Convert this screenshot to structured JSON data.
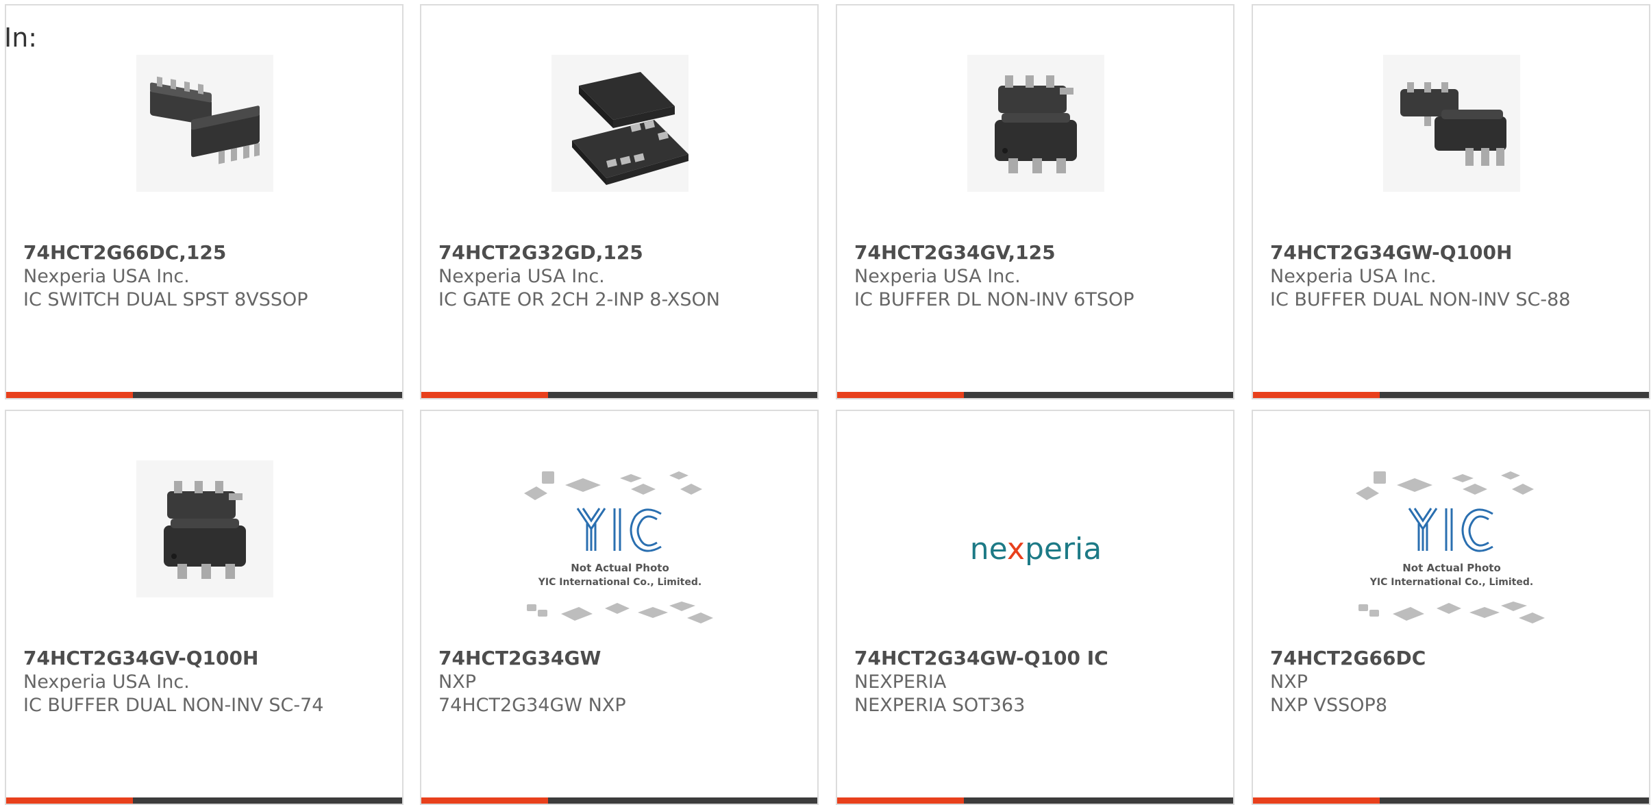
{
  "page": {
    "label": "In:"
  },
  "colors": {
    "accent": "#e8401c",
    "bar": "#3c3c3c",
    "border": "#dcdcdc",
    "text": "#4d4d4d",
    "muted": "#666666"
  },
  "cards": [
    {
      "part": "74HCT2G66DC,125",
      "manufacturer": "Nexperia USA Inc.",
      "description": "IC SWITCH DUAL SPST 8VSSOP",
      "image": "ic-8vssop-photo",
      "bar_fraction": 0.32
    },
    {
      "part": "74HCT2G32GD,125",
      "manufacturer": "Nexperia USA Inc.",
      "description": "IC GATE OR 2CH 2-INP 8-XSON",
      "image": "ic-xson-photo",
      "bar_fraction": 0.32
    },
    {
      "part": "74HCT2G34GV,125",
      "manufacturer": "Nexperia USA Inc.",
      "description": "IC BUFFER DL NON-INV 6TSOP",
      "image": "ic-6tsop-photo",
      "bar_fraction": 0.32
    },
    {
      "part": "74HCT2G34GW-Q100H",
      "manufacturer": "Nexperia USA Inc.",
      "description": "IC BUFFER DUAL NON-INV SC-88",
      "image": "ic-sc88-photo",
      "bar_fraction": 0.32
    },
    {
      "part": "74HCT2G34GV-Q100H",
      "manufacturer": "Nexperia USA Inc.",
      "description": "IC BUFFER DUAL NON-INV SC-74",
      "image": "ic-sc74-photo",
      "bar_fraction": 0.32
    },
    {
      "part": "74HCT2G34GW",
      "manufacturer": "NXP",
      "description": "74HCT2G34GW NXP",
      "image": "yic-placeholder-image",
      "placeholder": {
        "logo": "YIC",
        "line1": "Not Actual Photo",
        "line2": "YIC International Co., Limited."
      },
      "bar_fraction": 0.32
    },
    {
      "part": "74HCT2G34GW-Q100 IC",
      "manufacturer": "NEXPERIA",
      "description": "NEXPERIA SOT363",
      "image": "nexperia-logo",
      "logo_text": {
        "pre": "ne",
        "x": "x",
        "post": "peria"
      },
      "bar_fraction": 0.32
    },
    {
      "part": "74HCT2G66DC",
      "manufacturer": "NXP",
      "description": "NXP VSSOP8",
      "image": "yic-placeholder-image",
      "placeholder": {
        "logo": "YIC",
        "line1": "Not Actual Photo",
        "line2": "YIC International Co., Limited."
      },
      "bar_fraction": 0.32
    }
  ]
}
